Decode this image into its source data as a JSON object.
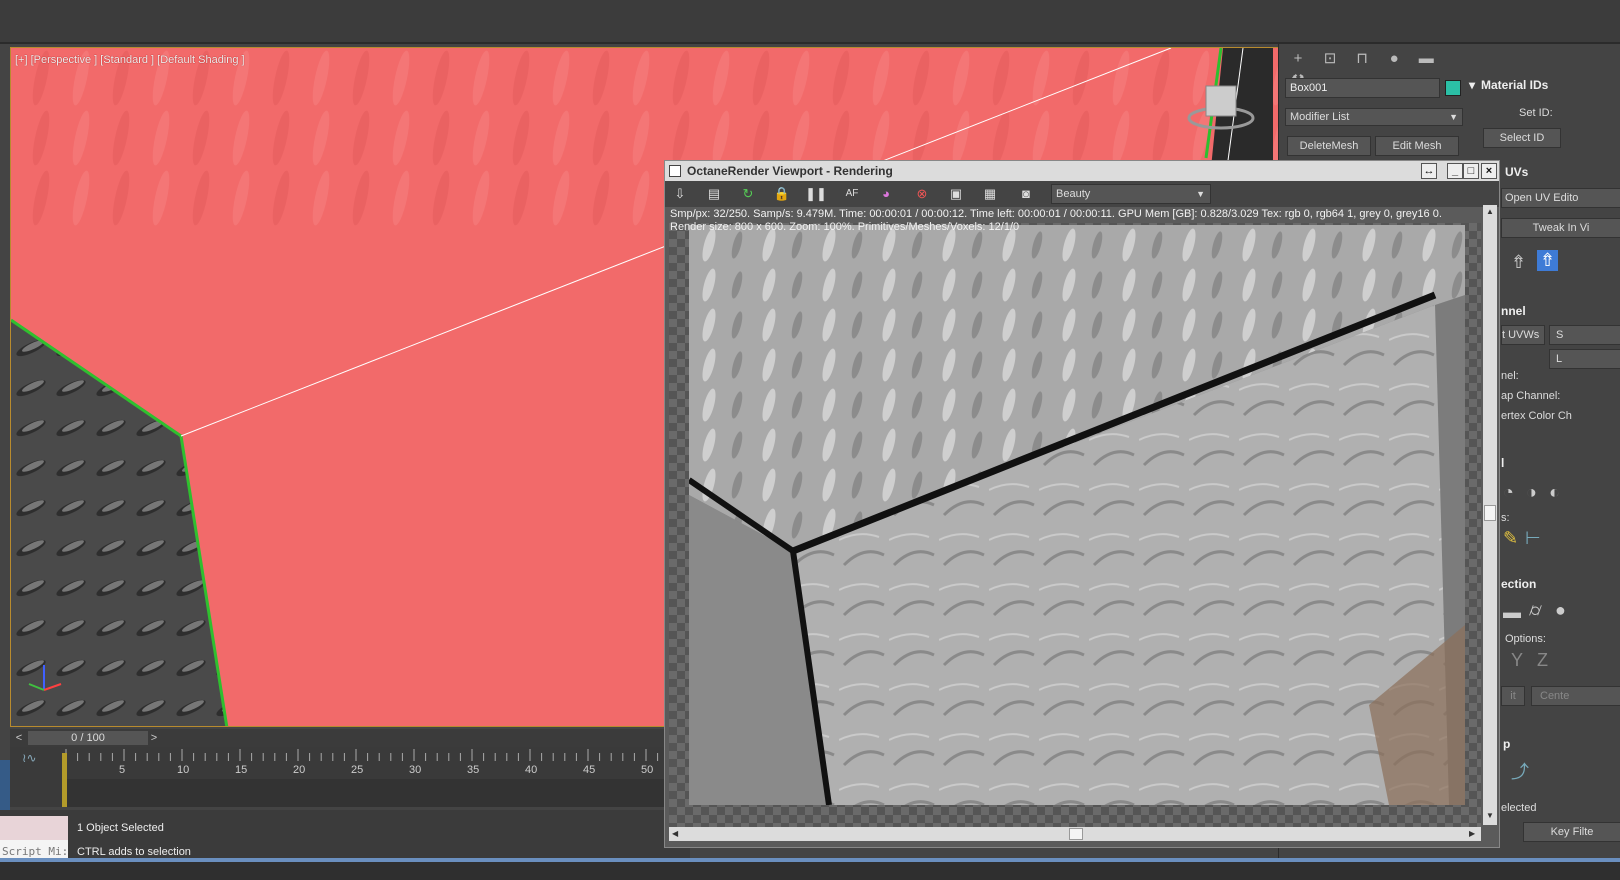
{
  "viewport": {
    "label": "[+] [Perspective ] [Standard ] [Default Shading ]"
  },
  "timeline": {
    "prev": "<",
    "next": ">",
    "frame": "0 / 100",
    "ticks": [
      "5",
      "10",
      "15",
      "20",
      "25",
      "30",
      "35",
      "40",
      "45",
      "50"
    ]
  },
  "status": {
    "script_label": "Script Mi:",
    "line1": "1 Object Selected",
    "line2": "CTRL adds to selection"
  },
  "command_panel": {
    "object_name": "Box001",
    "object_color": "#2bbfa6",
    "modifier_list": "Modifier List",
    "delete_mesh": "DeleteMesh",
    "edit_mesh": "Edit Mesh",
    "material_ids_title": "Material IDs",
    "set_id": "Set ID:",
    "select_id": "Select ID",
    "uvs_title": "UVs",
    "open_uv_editor": "Open UV Edito",
    "tweak_in_view": "Tweak In Vi",
    "channel_title": "nnel",
    "reset_uvws": "t UVWs",
    "channel_s": "S",
    "channel_l": "L",
    "channel_label": "nel:",
    "map_channel": "ap Channel:",
    "vertex_color": "ertex Color Ch",
    "section_l": "l",
    "s_label": "s:",
    "projection_title": "ection",
    "options_label": "Options:",
    "opt_y": "Y",
    "opt_z": "Z",
    "fit_btn": "it",
    "center_btn": "Cente",
    "wrap_title": "p",
    "selected_label": "elected",
    "key_filters": "Key Filte"
  },
  "octane": {
    "title": "OctaneRender Viewport - Rendering",
    "pass_select": "Beauty",
    "stats_line1": "Smp/px: 32/250.   Samp/s: 9.479M.   Time: 00:00:01 / 00:00:12.   Time left: 00:00:01 / 00:00:11.   GPU Mem [GB]: 0.828/3.029   Tex: rgb 0, rgb64 1, grey 0, grey16 0.",
    "stats_line2": "Render size: 800 x 600.   Zoom: 100%.   Primitives/Meshes/Voxels: 12/1/0",
    "win_restore": "↔",
    "win_min": "_",
    "win_max": "□",
    "win_close": "×"
  },
  "colors": {
    "viewport_red": "#f26a6a",
    "selection_green": "#2fbf2f",
    "ui_gray": "#444444"
  }
}
